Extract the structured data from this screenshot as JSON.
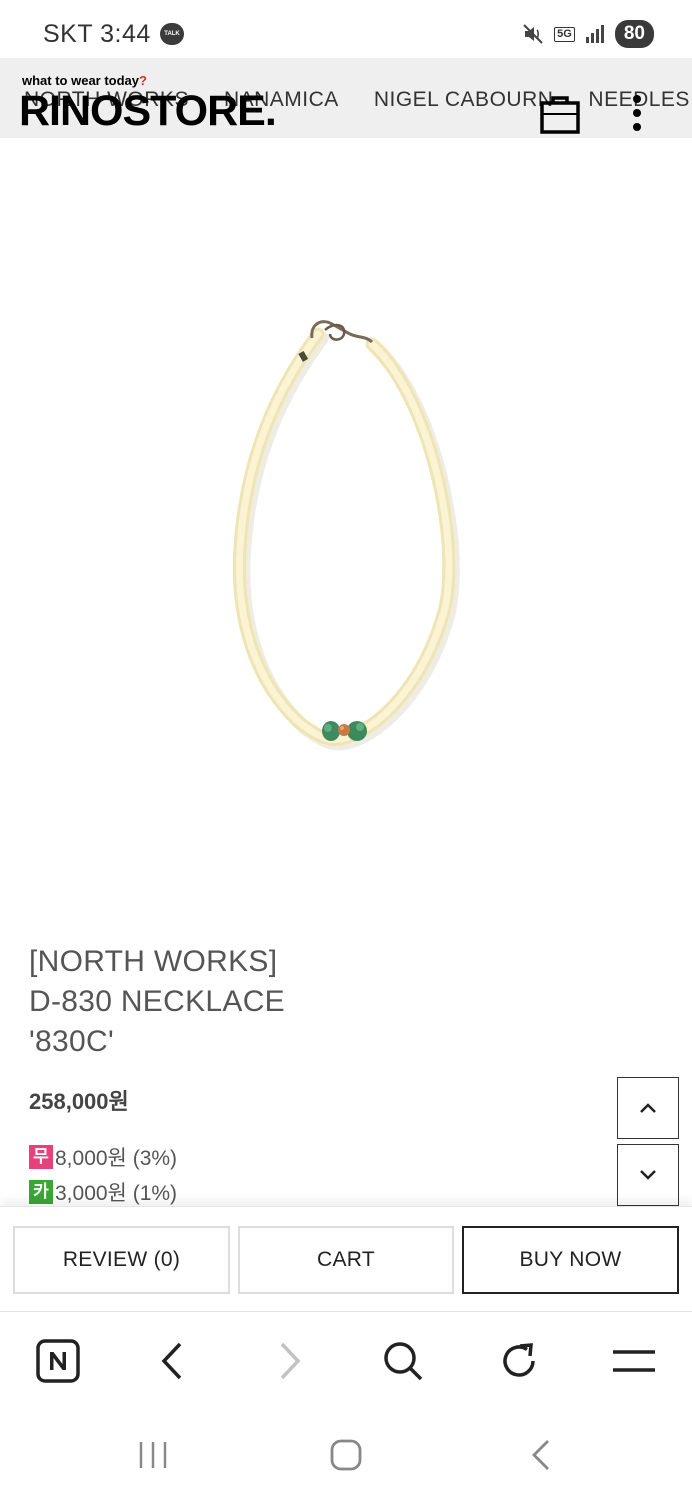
{
  "status_bar": {
    "carrier_time": "SKT 3:44",
    "talk_badge": "TALK",
    "network": "5G",
    "battery": "80"
  },
  "header": {
    "tagline": "what to wear today",
    "tagline_mark": "?",
    "logo": "RINOSTORE.",
    "brand_nav": [
      "NORTH WORKS",
      "NANAMICA",
      "NIGEL CABOURN",
      "NEEDLES"
    ]
  },
  "product": {
    "title_lines": [
      "[NORTH WORKS]",
      "D-830 NECKLACE",
      "'830C'"
    ],
    "price": "258,000원",
    "points": [
      {
        "badge": "무",
        "badge_color": "#e8407a",
        "text": "8,000원 (3%)"
      },
      {
        "badge": "카",
        "badge_color": "#3aa635",
        "text": "3,000원 (1%)"
      }
    ]
  },
  "actions": {
    "review": "REVIEW (0)",
    "cart": "CART",
    "buy_now": "BUY NOW"
  },
  "icons": {
    "bag": "shopping-bag-icon",
    "more": "more-vertical-icon",
    "scroll_up": "chevron-up-icon",
    "scroll_down": "chevron-down-icon",
    "browser": [
      "naver-home-icon",
      "back-icon",
      "forward-icon",
      "search-icon",
      "refresh-icon",
      "menu-icon"
    ],
    "system": [
      "recents-icon",
      "home-icon",
      "back-icon"
    ]
  }
}
